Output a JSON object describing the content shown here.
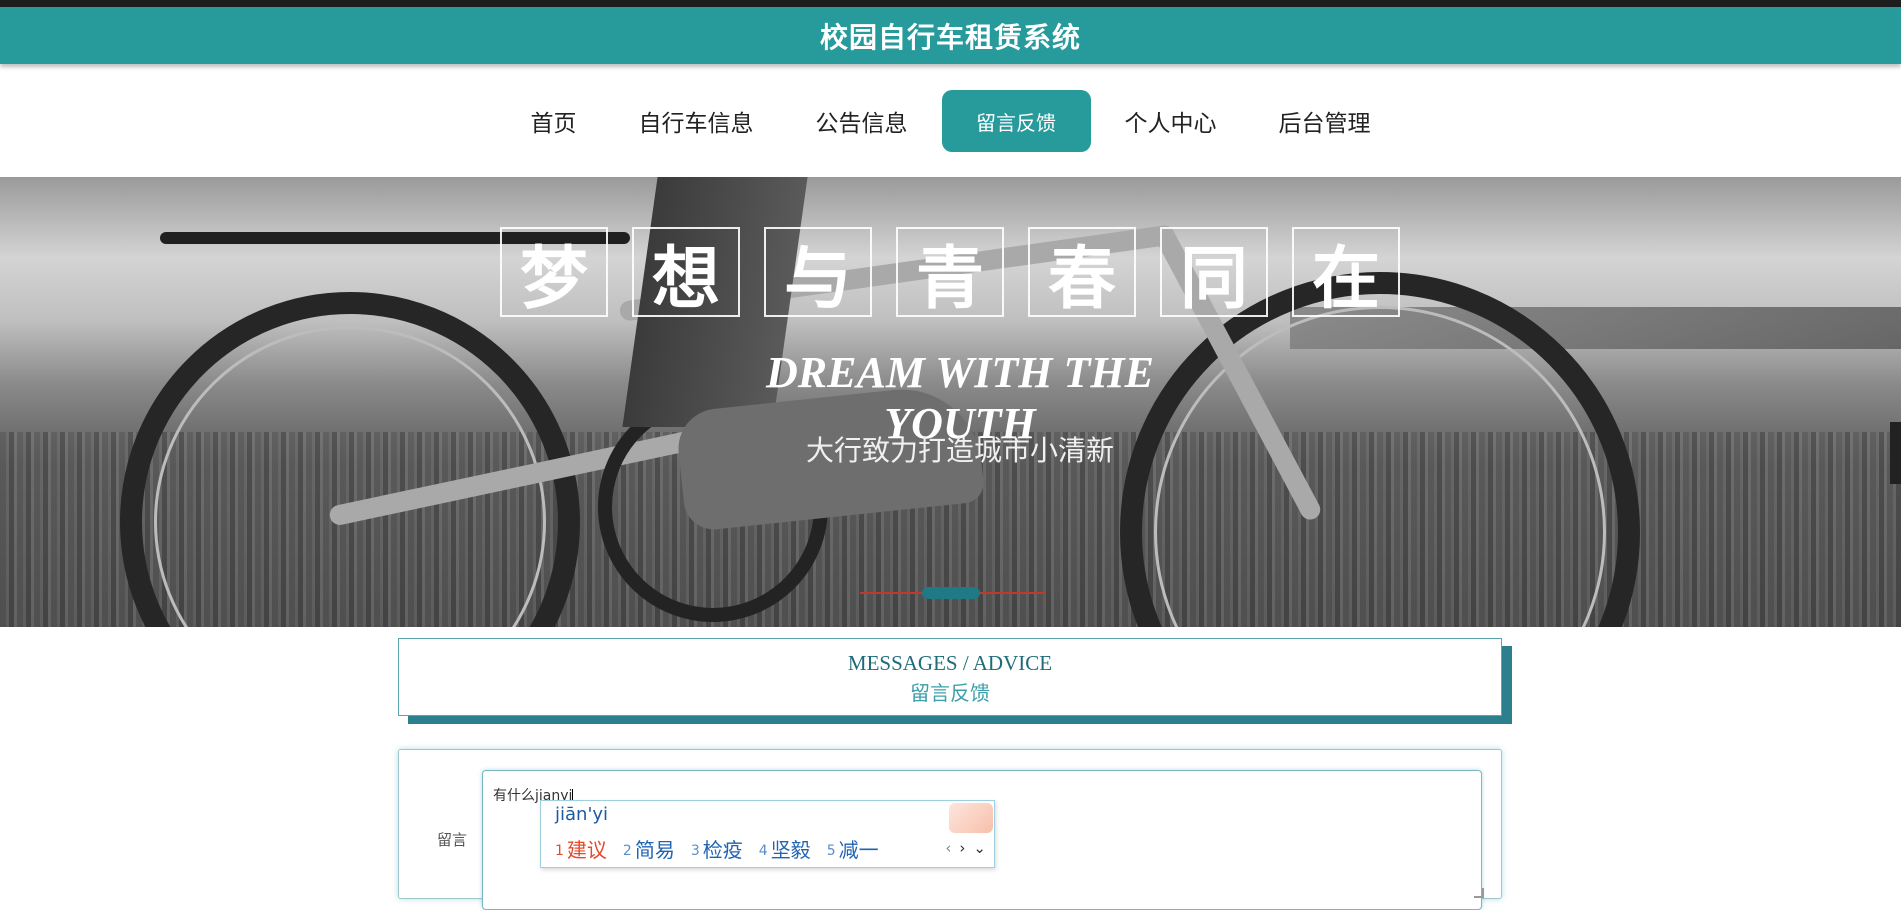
{
  "header": {
    "title": "校园自行车租赁系统"
  },
  "nav": {
    "items": [
      {
        "label": "首页"
      },
      {
        "label": "自行车信息"
      },
      {
        "label": "公告信息"
      },
      {
        "label": "留言反馈"
      },
      {
        "label": "个人中心"
      },
      {
        "label": "后台管理"
      }
    ],
    "active_index": 3
  },
  "banner": {
    "slogan_chars": [
      "梦",
      "想",
      "与",
      "青",
      "春",
      "同",
      "在"
    ],
    "slogan_en": "DREAM WITH THE YOUTH",
    "slogan_cn": "大行致力打造城市小清新"
  },
  "messages_section": {
    "title_en": "MESSAGES / ADVICE",
    "title_cn": "留言反馈"
  },
  "form": {
    "label": "留言",
    "textarea_value": "有什么jianyi"
  },
  "ime": {
    "composition": "jiān'yi",
    "candidates": [
      {
        "num": "1",
        "text": "建议"
      },
      {
        "num": "2",
        "text": "简易"
      },
      {
        "num": "3",
        "text": "检疫"
      },
      {
        "num": "4",
        "text": "坚毅"
      },
      {
        "num": "5",
        "text": "减一"
      }
    ],
    "prev": "‹",
    "next": "›",
    "expand": "⌄"
  },
  "colors": {
    "accent": "#279a9c",
    "dark_accent": "#2c7f8c",
    "ime_highlight": "#e34b2d"
  }
}
